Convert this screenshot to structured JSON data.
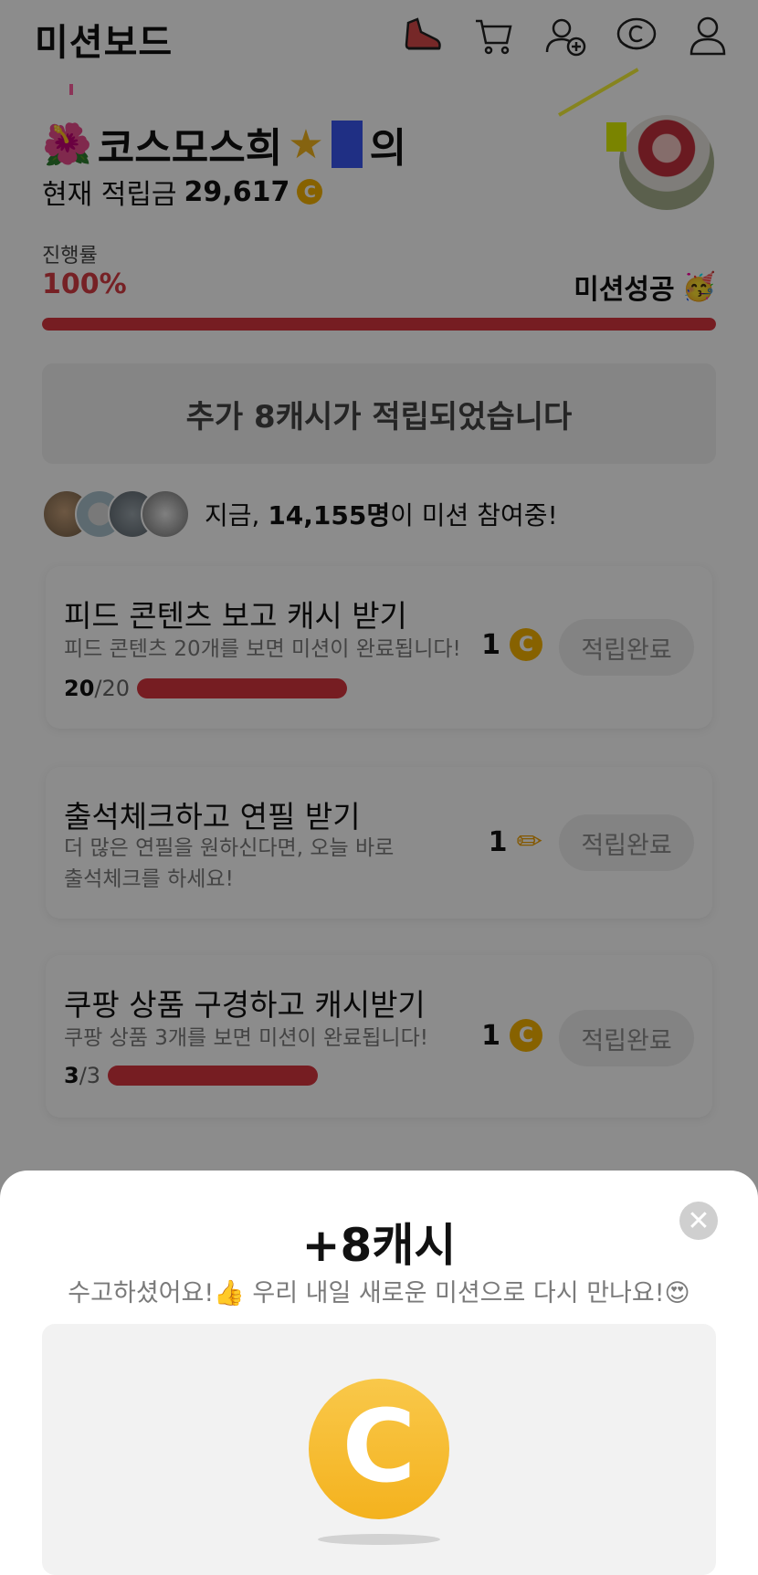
{
  "header": {
    "title": "미션보드",
    "icons": [
      "sneaker-icon",
      "cart-icon",
      "add-friend-icon",
      "cash-icon",
      "profile-icon"
    ]
  },
  "profile": {
    "name": "코스모스희",
    "suffix": "의",
    "points_label": "현재 적립금",
    "points_value": "29,617",
    "coin_symbol": "C"
  },
  "progress": {
    "label": "진행률",
    "value_text": "100%",
    "value_fraction": 1.0,
    "status": "미션성공",
    "status_emoji": "🥳"
  },
  "banner": {
    "text": "추가 8캐시가 적립되었습니다"
  },
  "participants": {
    "prefix": "지금,",
    "count": "14,155명",
    "suffix": "이 미션 참여중!"
  },
  "missions": [
    {
      "title": "피드 콘텐츠 보고 캐시 받기",
      "desc": "피드 콘텐츠 20개를 보면 미션이 완료됩니다!",
      "progress_done": "20",
      "progress_total": "/20",
      "reward_amount": "1",
      "reward_type": "coin",
      "button": "적립완료"
    },
    {
      "title": "출석체크하고 연필 받기",
      "desc_line1": "더 많은 연필을 원하신다면, 오늘 바로",
      "desc_line2": "출석체크를 하세요!",
      "reward_amount": "1",
      "reward_type": "pencil",
      "button": "적립완료"
    },
    {
      "title": "쿠팡 상품 구경하고 캐시받기",
      "desc": "쿠팡 상품 3개를 보면 미션이 완료됩니다!",
      "progress_done": "3",
      "progress_total": "/3",
      "reward_amount": "1",
      "reward_type": "coin",
      "button": "적립완료"
    }
  ],
  "sheet": {
    "title": "+8캐시",
    "message": "수고하셨어요!👍 우리 내일 새로운 미션으로 다시 만나요!😍",
    "close_symbol": "✕",
    "coin_symbol": "C"
  },
  "colors": {
    "accent_red": "#d8363f",
    "coin_yellow": "#f6b200"
  }
}
